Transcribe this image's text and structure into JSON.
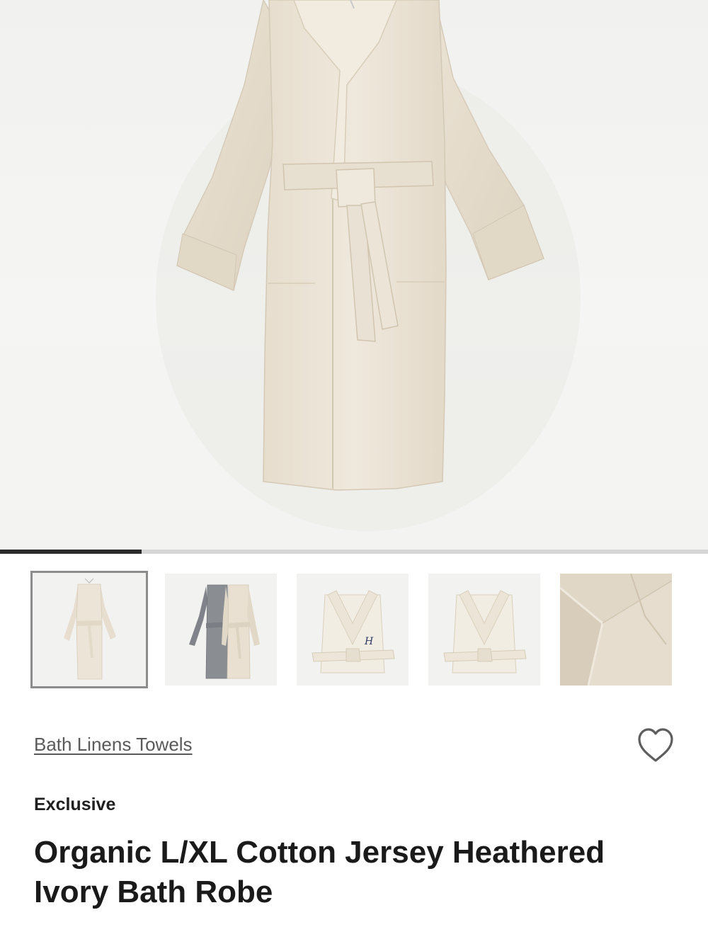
{
  "gallery": {
    "hero_image": "bath-robe-hanging-ivory-image",
    "progress_fraction": 0.2,
    "thumbnails": [
      {
        "name": "thumbnail-ivory-robe-hanging",
        "selected": true
      },
      {
        "name": "thumbnail-gray-and-ivory-robes",
        "selected": false
      },
      {
        "name": "thumbnail-folded-robe-monogram",
        "selected": false
      },
      {
        "name": "thumbnail-folded-robe",
        "selected": false
      },
      {
        "name": "thumbnail-fabric-closeup",
        "selected": false
      }
    ]
  },
  "product": {
    "category_link": "Bath Linens Towels",
    "badge": "Exclusive",
    "title": "Organic L/XL Cotton Jersey Heathered Ivory Bath Robe",
    "wishlist_icon": "heart-outline-icon"
  },
  "colors": {
    "robe_ivory": "#ece4d6",
    "robe_gray": "#8a8d92",
    "progress_active": "#2a2a2a",
    "progress_track": "#d6d6d6",
    "thumb_border": "#8c8c8c"
  }
}
